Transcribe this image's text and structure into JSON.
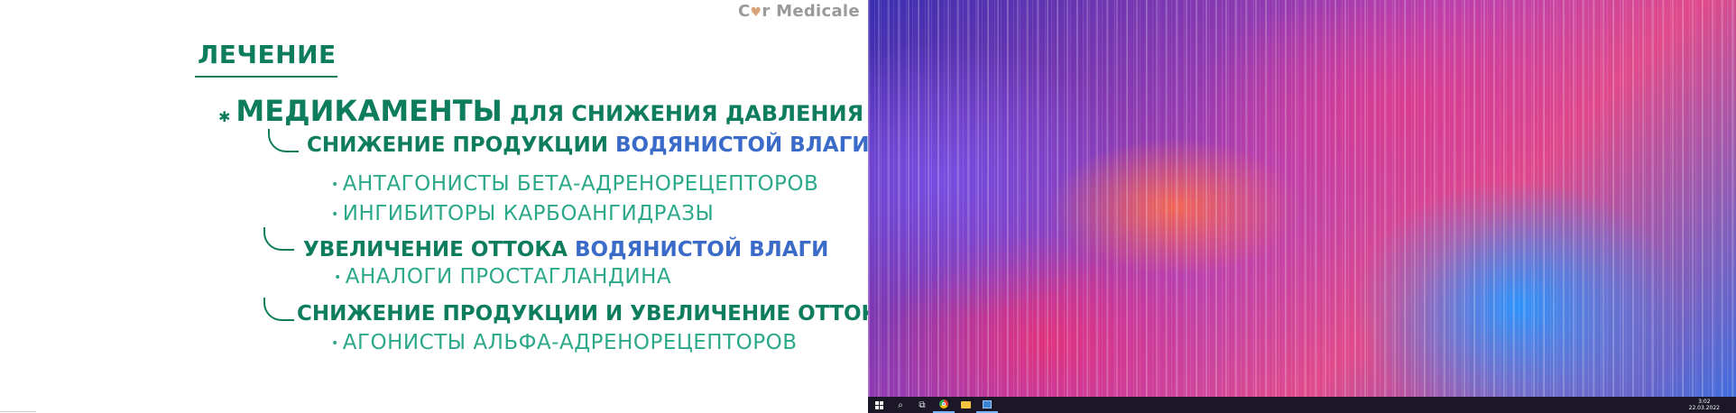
{
  "slide": {
    "brand_pre": "C",
    "brand_heart": "♥",
    "brand_post": "r Medicale",
    "title": "ЛЕЧЕНИЕ",
    "level1": {
      "bullet": "✱",
      "main": "МЕДИКАМЕНТЫ",
      "rest": " ДЛЯ СНИЖЕНИЯ ДАВЛЕНИЯ"
    },
    "groups": [
      {
        "head_green": "СНИЖЕНИЕ ПРОДУКЦИИ ",
        "head_blue": "ВОДЯНИСТОЙ ВЛАГИ",
        "items": [
          "АНТАГОНИСТЫ БЕТА-АДРЕНОРЕЦЕПТОРОВ",
          "ИНГИБИТОРЫ КАРБОАНГИДРАЗЫ"
        ]
      },
      {
        "head_green": "УВЕЛИЧЕНИЕ ОТТОКА ",
        "head_blue": "ВОДЯНИСТОЙ ВЛАГИ",
        "items": [
          "АНАЛОГИ ПРОСТАГЛАНДИНА"
        ]
      },
      {
        "head_green": "СНИЖЕНИЕ ПРОДУКЦИИ И УВЕЛИЧЕНИЕ ОТТОКА",
        "head_blue": "",
        "items": [
          "АГОНИСТЫ АЛЬФА-АДРЕНОРЕЦЕПТОРОВ"
        ]
      }
    ],
    "item_bullet": "•"
  },
  "taskbar": {
    "search_glyph": "⌕",
    "taskview_glyph": "⧉",
    "clock_time": "3:02",
    "clock_date": "22.03.2022"
  },
  "colors": {
    "green_primary": "#0e7d5d",
    "green_light": "#2ca88a",
    "blue_accent": "#3b6bc8",
    "taskbar": "#1b1726"
  },
  "icons": [
    "windows-start-icon",
    "search-icon",
    "task-view-icon",
    "chrome-icon",
    "file-explorer-icon",
    "app-icon"
  ]
}
